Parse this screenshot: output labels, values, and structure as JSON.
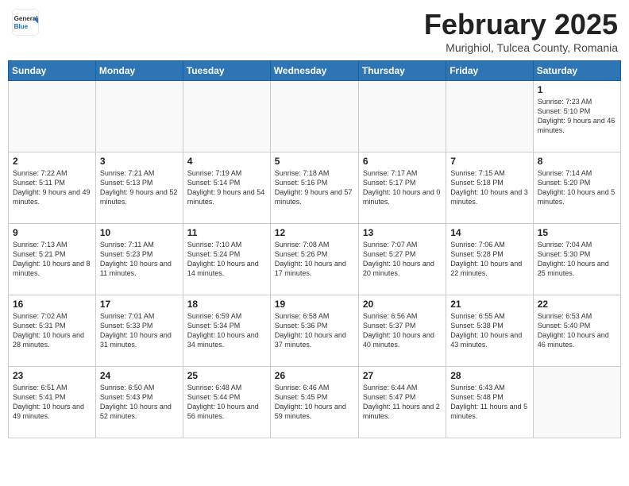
{
  "header": {
    "logo_general": "General",
    "logo_blue": "Blue",
    "month_year": "February 2025",
    "location": "Murighiol, Tulcea County, Romania"
  },
  "weekdays": [
    "Sunday",
    "Monday",
    "Tuesday",
    "Wednesday",
    "Thursday",
    "Friday",
    "Saturday"
  ],
  "weeks": [
    [
      {
        "day": "",
        "info": ""
      },
      {
        "day": "",
        "info": ""
      },
      {
        "day": "",
        "info": ""
      },
      {
        "day": "",
        "info": ""
      },
      {
        "day": "",
        "info": ""
      },
      {
        "day": "",
        "info": ""
      },
      {
        "day": "1",
        "info": "Sunrise: 7:23 AM\nSunset: 5:10 PM\nDaylight: 9 hours and 46 minutes."
      }
    ],
    [
      {
        "day": "2",
        "info": "Sunrise: 7:22 AM\nSunset: 5:11 PM\nDaylight: 9 hours and 49 minutes."
      },
      {
        "day": "3",
        "info": "Sunrise: 7:21 AM\nSunset: 5:13 PM\nDaylight: 9 hours and 52 minutes."
      },
      {
        "day": "4",
        "info": "Sunrise: 7:19 AM\nSunset: 5:14 PM\nDaylight: 9 hours and 54 minutes."
      },
      {
        "day": "5",
        "info": "Sunrise: 7:18 AM\nSunset: 5:16 PM\nDaylight: 9 hours and 57 minutes."
      },
      {
        "day": "6",
        "info": "Sunrise: 7:17 AM\nSunset: 5:17 PM\nDaylight: 10 hours and 0 minutes."
      },
      {
        "day": "7",
        "info": "Sunrise: 7:15 AM\nSunset: 5:18 PM\nDaylight: 10 hours and 3 minutes."
      },
      {
        "day": "8",
        "info": "Sunrise: 7:14 AM\nSunset: 5:20 PM\nDaylight: 10 hours and 5 minutes."
      }
    ],
    [
      {
        "day": "9",
        "info": "Sunrise: 7:13 AM\nSunset: 5:21 PM\nDaylight: 10 hours and 8 minutes."
      },
      {
        "day": "10",
        "info": "Sunrise: 7:11 AM\nSunset: 5:23 PM\nDaylight: 10 hours and 11 minutes."
      },
      {
        "day": "11",
        "info": "Sunrise: 7:10 AM\nSunset: 5:24 PM\nDaylight: 10 hours and 14 minutes."
      },
      {
        "day": "12",
        "info": "Sunrise: 7:08 AM\nSunset: 5:26 PM\nDaylight: 10 hours and 17 minutes."
      },
      {
        "day": "13",
        "info": "Sunrise: 7:07 AM\nSunset: 5:27 PM\nDaylight: 10 hours and 20 minutes."
      },
      {
        "day": "14",
        "info": "Sunrise: 7:06 AM\nSunset: 5:28 PM\nDaylight: 10 hours and 22 minutes."
      },
      {
        "day": "15",
        "info": "Sunrise: 7:04 AM\nSunset: 5:30 PM\nDaylight: 10 hours and 25 minutes."
      }
    ],
    [
      {
        "day": "16",
        "info": "Sunrise: 7:02 AM\nSunset: 5:31 PM\nDaylight: 10 hours and 28 minutes."
      },
      {
        "day": "17",
        "info": "Sunrise: 7:01 AM\nSunset: 5:33 PM\nDaylight: 10 hours and 31 minutes."
      },
      {
        "day": "18",
        "info": "Sunrise: 6:59 AM\nSunset: 5:34 PM\nDaylight: 10 hours and 34 minutes."
      },
      {
        "day": "19",
        "info": "Sunrise: 6:58 AM\nSunset: 5:36 PM\nDaylight: 10 hours and 37 minutes."
      },
      {
        "day": "20",
        "info": "Sunrise: 6:56 AM\nSunset: 5:37 PM\nDaylight: 10 hours and 40 minutes."
      },
      {
        "day": "21",
        "info": "Sunrise: 6:55 AM\nSunset: 5:38 PM\nDaylight: 10 hours and 43 minutes."
      },
      {
        "day": "22",
        "info": "Sunrise: 6:53 AM\nSunset: 5:40 PM\nDaylight: 10 hours and 46 minutes."
      }
    ],
    [
      {
        "day": "23",
        "info": "Sunrise: 6:51 AM\nSunset: 5:41 PM\nDaylight: 10 hours and 49 minutes."
      },
      {
        "day": "24",
        "info": "Sunrise: 6:50 AM\nSunset: 5:43 PM\nDaylight: 10 hours and 52 minutes."
      },
      {
        "day": "25",
        "info": "Sunrise: 6:48 AM\nSunset: 5:44 PM\nDaylight: 10 hours and 56 minutes."
      },
      {
        "day": "26",
        "info": "Sunrise: 6:46 AM\nSunset: 5:45 PM\nDaylight: 10 hours and 59 minutes."
      },
      {
        "day": "27",
        "info": "Sunrise: 6:44 AM\nSunset: 5:47 PM\nDaylight: 11 hours and 2 minutes."
      },
      {
        "day": "28",
        "info": "Sunrise: 6:43 AM\nSunset: 5:48 PM\nDaylight: 11 hours and 5 minutes."
      },
      {
        "day": "",
        "info": ""
      }
    ]
  ]
}
